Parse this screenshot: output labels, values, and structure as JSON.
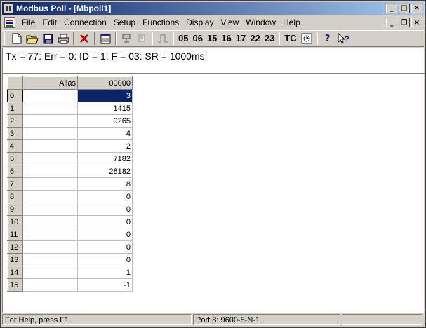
{
  "window": {
    "title": "Modbus Poll - [Mbpoll1]"
  },
  "title_buttons": {
    "minimize": "_",
    "maximize": "□",
    "close": "×"
  },
  "menu": [
    "File",
    "Edit",
    "Connection",
    "Setup",
    "Functions",
    "Display",
    "View",
    "Window",
    "Help"
  ],
  "mdi_buttons": {
    "minimize": "_",
    "restore": "❐",
    "close": "×"
  },
  "toolbar": {
    "functions": [
      "05",
      "06",
      "15",
      "16",
      "17",
      "22",
      "23"
    ],
    "tc_label": "TC"
  },
  "status_line": "Tx = 77: Err = 0: ID = 1: F = 03: SR = 1000ms",
  "grid": {
    "headers": {
      "alias": "Alias",
      "value": "00000"
    },
    "rows": [
      {
        "num": "0",
        "alias": "",
        "value": "3",
        "selected": true
      },
      {
        "num": "1",
        "alias": "",
        "value": "1415"
      },
      {
        "num": "2",
        "alias": "",
        "value": "9265"
      },
      {
        "num": "3",
        "alias": "",
        "value": "4"
      },
      {
        "num": "4",
        "alias": "",
        "value": "2"
      },
      {
        "num": "5",
        "alias": "",
        "value": "7182"
      },
      {
        "num": "6",
        "alias": "",
        "value": "28182"
      },
      {
        "num": "7",
        "alias": "",
        "value": "8"
      },
      {
        "num": "8",
        "alias": "",
        "value": "0"
      },
      {
        "num": "9",
        "alias": "",
        "value": "0"
      },
      {
        "num": "10",
        "alias": "",
        "value": "0"
      },
      {
        "num": "11",
        "alias": "",
        "value": "0"
      },
      {
        "num": "12",
        "alias": "",
        "value": "0"
      },
      {
        "num": "13",
        "alias": "",
        "value": "0"
      },
      {
        "num": "14",
        "alias": "",
        "value": "1"
      },
      {
        "num": "15",
        "alias": "",
        "value": "-1"
      }
    ]
  },
  "statusbar": {
    "help": "For Help, press F1.",
    "port": "Port 8: 9600-8-N-1"
  },
  "colors": {
    "title_start": "#0a246a",
    "title_end": "#a6caf0",
    "selection": "#0a246a",
    "face": "#d4d0c8"
  }
}
